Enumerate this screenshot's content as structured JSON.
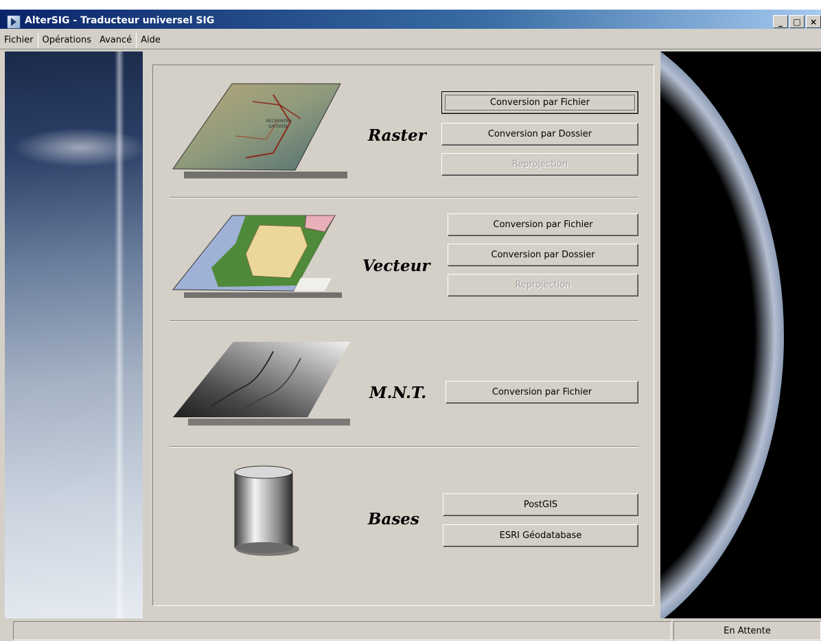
{
  "window": {
    "title": "AlterSIG - Traducteur universel SIG",
    "controls": [
      "minimize-icon",
      "maximize-icon",
      "close-icon"
    ],
    "control_glyphs": {
      "minimize": "_",
      "maximize": "□",
      "close": "×"
    }
  },
  "menu": {
    "fichier": "Fichier",
    "operations": "Opérations",
    "avance": "Avancé",
    "aide": "Aide"
  },
  "sections": {
    "raster": {
      "title": "Raster",
      "buttons": {
        "file": "Conversion par Fichier",
        "folder": "Conversion par Dossier",
        "reprojection": "Reprojection"
      },
      "map_labels": [
        "KECAMATAN",
        "SAFEKEN"
      ]
    },
    "vecteur": {
      "title": "Vecteur",
      "buttons": {
        "file": "Conversion par Fichier",
        "folder": "Conversion par Dossier",
        "reprojection": "Reprojection"
      }
    },
    "mnt": {
      "title": "M.N.T.",
      "buttons": {
        "file": "Conversion par Fichier"
      }
    },
    "bases": {
      "title": "Bases",
      "buttons": {
        "postgis": "PostGIS",
        "esri": "ESRI Géodatabase"
      }
    }
  },
  "status": {
    "message": "",
    "state": "En Attente"
  },
  "colors": {
    "face": "#d4d0c8",
    "title_dark": "#0a246a",
    "title_light": "#a6caf0",
    "disabled_text": "#a0a0a0"
  }
}
